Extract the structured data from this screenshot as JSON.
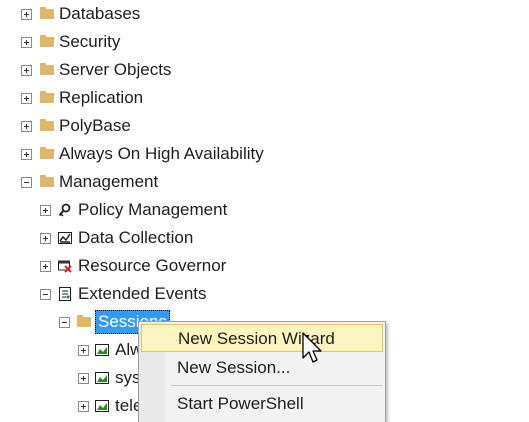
{
  "tree": {
    "root_items": [
      {
        "label": "Databases"
      },
      {
        "label": "Security"
      },
      {
        "label": "Server Objects"
      },
      {
        "label": "Replication"
      },
      {
        "label": "PolyBase"
      },
      {
        "label": "Always On High Availability"
      },
      {
        "label": "Management"
      }
    ],
    "management_children": [
      {
        "label": "Policy Management",
        "icon": "policy-icon"
      },
      {
        "label": "Data Collection",
        "icon": "data-collection-icon"
      },
      {
        "label": "Resource Governor",
        "icon": "resource-governor-icon"
      },
      {
        "label": "Extended Events",
        "icon": "extended-events-icon"
      }
    ],
    "sessions": {
      "label": "Sessions",
      "children": [
        {
          "label": "Alw"
        },
        {
          "label": "sys"
        },
        {
          "label": "tele"
        }
      ]
    }
  },
  "context_menu": {
    "items": [
      {
        "label": "New Session Wizard"
      },
      {
        "label": "New Session..."
      },
      {
        "label": "Start PowerShell"
      }
    ]
  },
  "colors": {
    "selection": "#3399ff",
    "folder": "#dcb867",
    "menu_hover": "#fdf4bf"
  }
}
